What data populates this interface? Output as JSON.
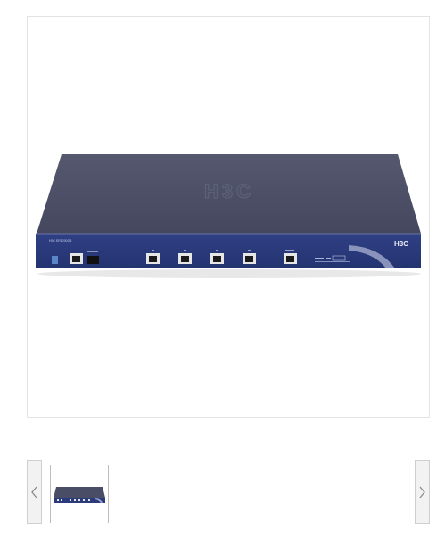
{
  "product": {
    "brand_logo": "H3C",
    "emboss_logo": "H3C",
    "model_label": "H3C  ER5200G3",
    "image_name": "h3c-router-front-view"
  },
  "gallery": {
    "thumbnails": [
      {
        "selected": true
      }
    ],
    "prev_icon": "chevron-left-icon",
    "next_icon": "chevron-right-icon"
  },
  "colors": {
    "chassis_top": "#4a4d66",
    "front_panel": "#2d3c7c",
    "frame_border": "#e3e3e3"
  }
}
